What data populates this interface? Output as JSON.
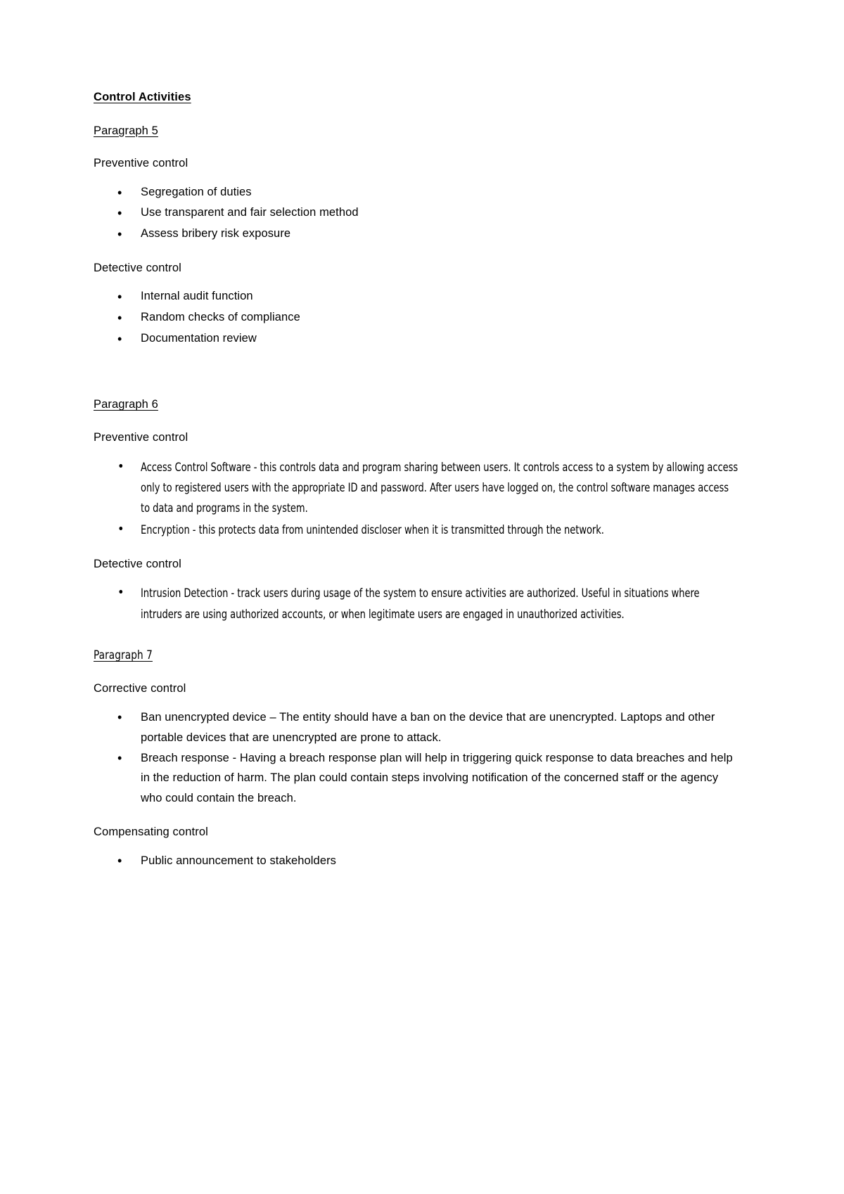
{
  "document": {
    "heading": "Control Activities ",
    "sections": [
      {
        "id": "paragraph-5",
        "title": "Paragraph 5 ",
        "groups": [
          {
            "label": "Preventive control",
            "items": [
              "Segregation of duties",
              "Use transparent and fair selection method",
              "Assess bribery risk exposure"
            ]
          },
          {
            "label": "Detective control",
            "items": [
              "Internal audit function",
              "Random checks of compliance",
              "Documentation review"
            ]
          }
        ]
      },
      {
        "id": "paragraph-6",
        "title": "Paragraph 6",
        "groups": [
          {
            "label": "Preventive control",
            "items": [
              "Access Control Software - this controls data and program sharing between users. It controls access to a system by allowing access only to registered users with the appropriate ID and password. After users have logged on, the control software manages access to data and programs in the system.",
              "Encryption - this protects data from unintended discloser when it is transmitted through the network."
            ]
          },
          {
            "label": "Detective control",
            "items": [
              "Intrusion Detection - track users during usage of the system to ensure activities are authorized. Useful in situations where intruders are using authorized accounts, or when legitimate users are engaged in unauthorized activities."
            ]
          }
        ]
      },
      {
        "id": "paragraph-7",
        "title": "Paragraph 7",
        "groups": [
          {
            "label": "Corrective control",
            "items": [
              "Ban unencrypted device – The entity should have a ban on the device that are unencrypted. Laptops and other portable devices that are unencrypted are prone to attack.",
              "Breach response - Having a breach response plan will help in triggering quick response to data breaches and help in the reduction of harm. The plan could contain steps involving notification of the concerned staff or the agency who could contain the breach."
            ]
          },
          {
            "label": "Compensating control",
            "items": [
              "Public announcement to stakeholders"
            ]
          }
        ]
      }
    ]
  }
}
